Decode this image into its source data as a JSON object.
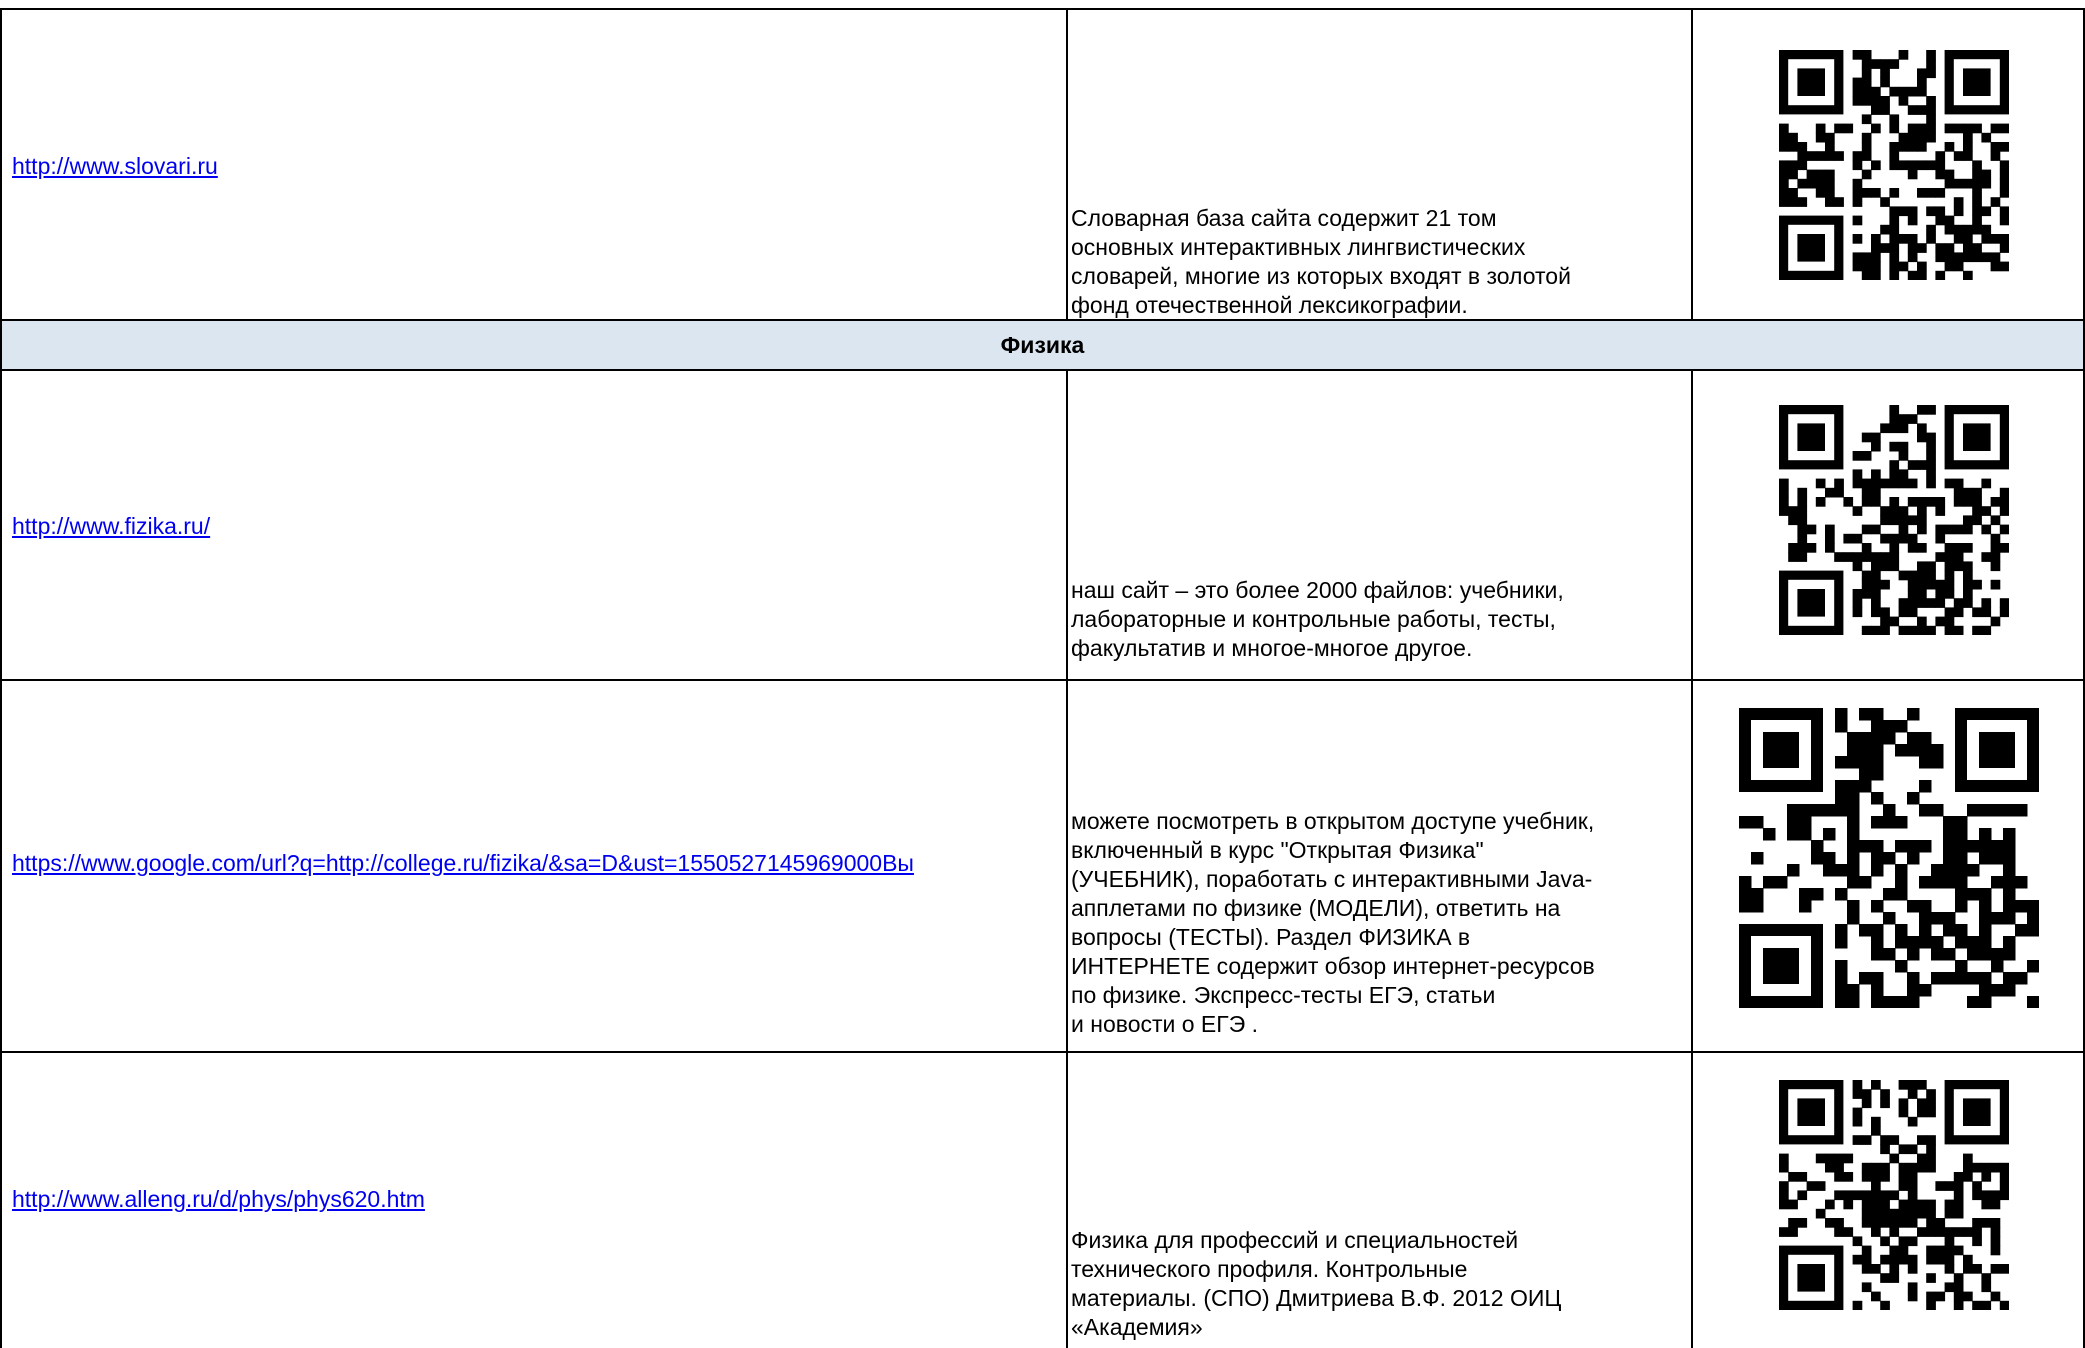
{
  "section_title": "Физика",
  "rows": [
    {
      "url": "http://www.slovari.ru",
      "description": "Словарная база сайта содержит 21 том\nосновных интерактивных лингвистических\nсловарей, многие из которых входят в золотой\nфонд отечественной лексикографии."
    },
    {
      "url": "http://www.fizika.ru/",
      "description": "наш сайт – это более 2000 файлов: учебники,\nлабораторные и контрольные работы, тесты,\nфакультатив и многое-многое другое."
    },
    {
      "url": "https://www.google.com/url?q=http://college.ru/fizika/&sa=D&ust=1550527145969000Вы",
      "description": "можете посмотреть в открытом доступе учебник,\nвключенный в курс \"Открытая Физика\"\n(УЧЕБНИК), поработать с интерактивными Java-\nапплетами по физике (МОДЕЛИ), ответить на\nвопросы (ТЕСТЫ). Раздел ФИЗИКА в\nИНТЕРНЕТЕ содержит обзор интернет-ресурсов\nпо физике. Экспресс-тесты ЕГЭ, статьи\nи новости о ЕГЭ ."
    },
    {
      "url": "http://www.alleng.ru/d/phys/phys620.htm",
      "description": "Физика для профессий и специальностей\nтехнического профиля. Контрольные\nматериалы. (СПО) Дмитриева В.Ф. 2012 ОИЦ\n«Академия»"
    }
  ],
  "icons": {
    "qr": "qr-code-icon"
  },
  "colors": {
    "link": "#0000ee",
    "section_bg": "#dce6f1",
    "border": "#000000"
  }
}
